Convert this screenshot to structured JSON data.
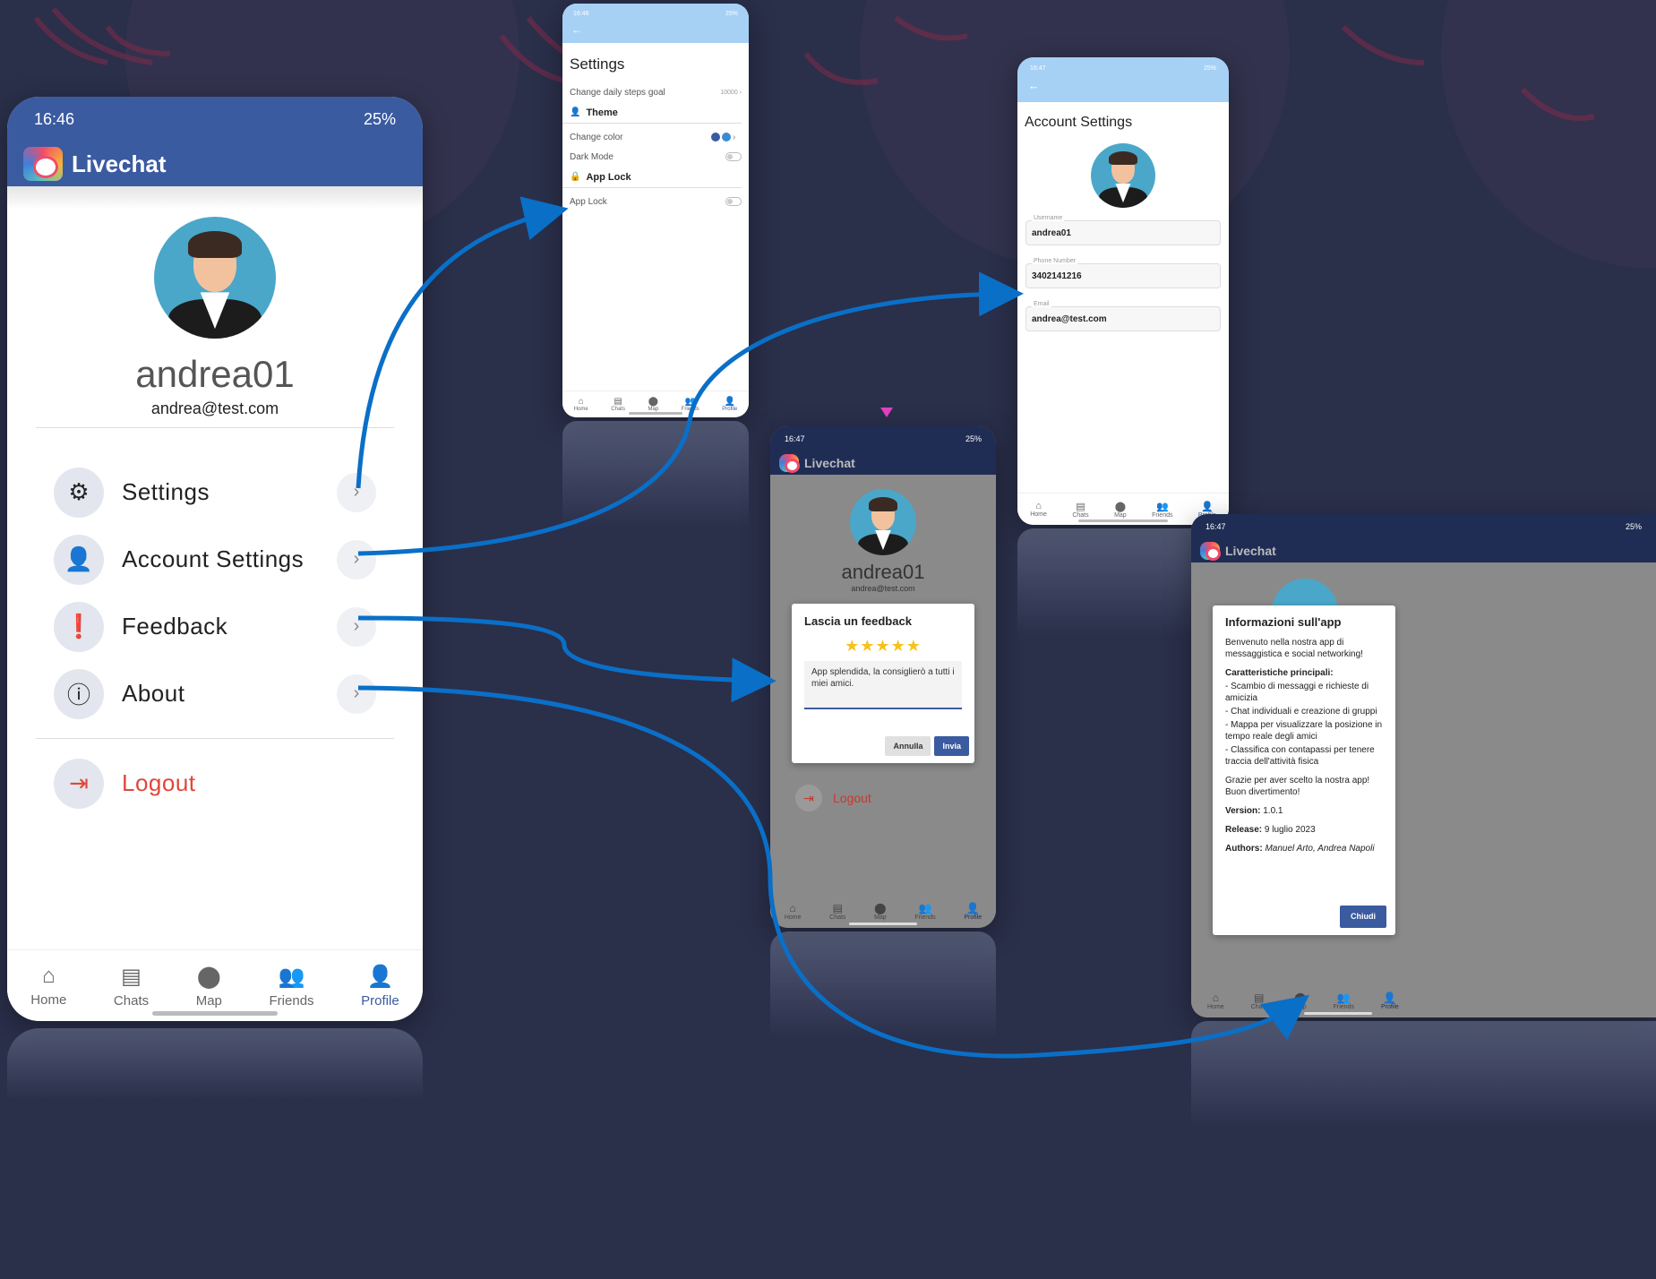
{
  "colors": {
    "primary": "#3a5ba0",
    "dark_primary": "#1f2d55",
    "light_primary": "#a7d0f5",
    "arrow": "#0a6fc7",
    "logout": "#e0473a",
    "star": "#f6c21b"
  },
  "main": {
    "status": {
      "time": "16:46",
      "battery": "25%"
    },
    "app_title": "Livechat",
    "username": "andrea01",
    "email": "andrea@test.com",
    "menu": [
      {
        "label": "Settings",
        "icon": "gear-icon"
      },
      {
        "label": "Account Settings",
        "icon": "user-gear-icon"
      },
      {
        "label": "Feedback",
        "icon": "feedback-icon"
      },
      {
        "label": "About",
        "icon": "info-icon"
      }
    ],
    "logout": "Logout",
    "nav": [
      "Home",
      "Chats",
      "Map",
      "Friends",
      "Profile"
    ]
  },
  "settings_screen": {
    "status": {
      "time": "16:46",
      "battery": "25%"
    },
    "title": "Settings",
    "steps_label": "Change daily steps goal",
    "steps_value": "10000",
    "theme_header": "Theme",
    "color_label": "Change color",
    "dark_mode_label": "Dark Mode",
    "applock_header": "App Lock",
    "applock_label": "App Lock",
    "nav": [
      "Home",
      "Chats",
      "Map",
      "Friends",
      "Profile"
    ]
  },
  "account_screen": {
    "status": {
      "time": "16:47",
      "battery": "25%"
    },
    "title": "Account Settings",
    "fields": [
      {
        "label": "Username",
        "value": "andrea01"
      },
      {
        "label": "Phone Number",
        "value": "3402141216"
      },
      {
        "label": "Email",
        "value": "andrea@test.com"
      }
    ],
    "nav": [
      "Home",
      "Chats",
      "Map",
      "Friends",
      "Profile"
    ]
  },
  "feedback_screen": {
    "status": {
      "time": "16:47",
      "battery": "25%"
    },
    "app_title": "Livechat",
    "username": "andrea01",
    "email": "andrea@test.com",
    "dialog_title": "Lascia un feedback",
    "stars": "★★★★★",
    "rating": 5,
    "text": "App splendida, la consiglierò a tutti i miei amici.",
    "cancel": "Annulla",
    "send": "Invia",
    "logout": "Logout",
    "nav": [
      "Home",
      "Chats",
      "Map",
      "Friends",
      "Profile"
    ]
  },
  "about_screen": {
    "status": {
      "time": "16:47",
      "battery": "25%"
    },
    "app_title": "Livechat",
    "dialog_title": "Informazioni sull'app",
    "intro": "Benvenuto nella nostra app di messaggistica e social networking!",
    "features_title": "Caratteristiche principali:",
    "features": [
      "- Scambio di messaggi e richieste di amicizia",
      "- Chat individuali e creazione di gruppi",
      "- Mappa per visualizzare la posizione in tempo reale degli amici",
      "- Classifica con contapassi per tenere traccia dell'attività fisica"
    ],
    "thanks": "Grazie per aver scelto la nostra app! Buon divertimento!",
    "version_label": "Version:",
    "version": "1.0.1",
    "release_label": "Release:",
    "release": "9 luglio 2023",
    "authors_label": "Authors:",
    "authors": "Manuel Arto, Andrea Napoli",
    "close": "Chiudi",
    "nav": [
      "Home",
      "Chats",
      "Map",
      "Friends",
      "Profile"
    ]
  }
}
